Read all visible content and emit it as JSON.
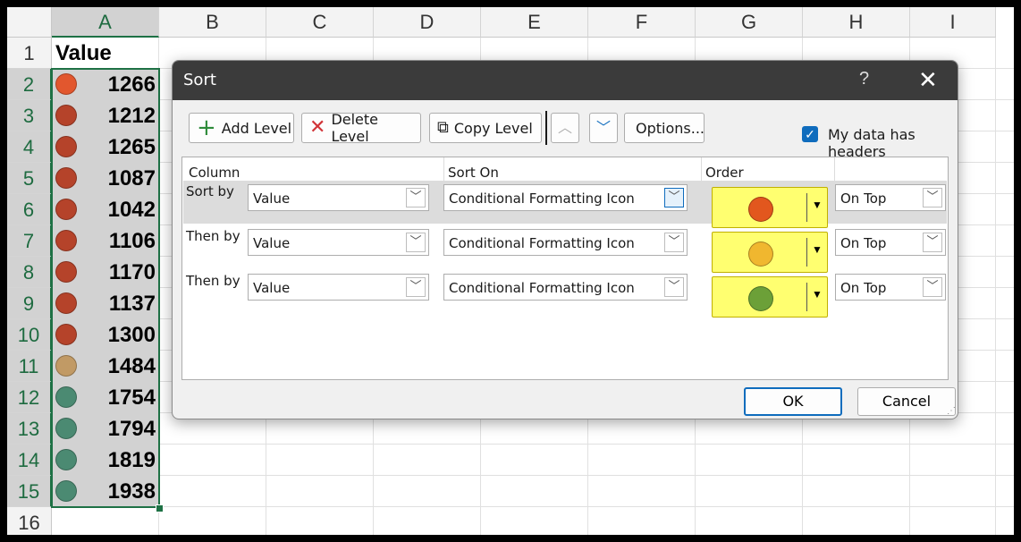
{
  "sheet": {
    "columns": [
      "A",
      "B",
      "C",
      "D",
      "E",
      "F",
      "G",
      "H",
      "I"
    ],
    "rows": [
      "1",
      "2",
      "3",
      "4",
      "5",
      "6",
      "7",
      "8",
      "9",
      "10",
      "11",
      "12",
      "13",
      "14",
      "15",
      "16"
    ],
    "header": "Value",
    "cells": [
      {
        "value": "1266",
        "icon": "orange-red-circle-icon",
        "color": "#e2572e"
      },
      {
        "value": "1212",
        "icon": "red-circle-icon",
        "color": "#b5432a"
      },
      {
        "value": "1265",
        "icon": "red-circle-icon",
        "color": "#b5432a"
      },
      {
        "value": "1087",
        "icon": "red-circle-icon",
        "color": "#b5432a"
      },
      {
        "value": "1042",
        "icon": "red-circle-icon",
        "color": "#b5432a"
      },
      {
        "value": "1106",
        "icon": "red-circle-icon",
        "color": "#b5432a"
      },
      {
        "value": "1170",
        "icon": "red-circle-icon",
        "color": "#b5432a"
      },
      {
        "value": "1137",
        "icon": "red-circle-icon",
        "color": "#b5432a"
      },
      {
        "value": "1300",
        "icon": "red-circle-icon",
        "color": "#b5432a"
      },
      {
        "value": "1484",
        "icon": "tan-circle-icon",
        "color": "#c19a65"
      },
      {
        "value": "1754",
        "icon": "green-circle-icon",
        "color": "#4b8a72"
      },
      {
        "value": "1794",
        "icon": "green-circle-icon",
        "color": "#4b8a72"
      },
      {
        "value": "1819",
        "icon": "green-circle-icon",
        "color": "#4b8a72"
      },
      {
        "value": "1938",
        "icon": "green-circle-icon",
        "color": "#4b8a72"
      }
    ]
  },
  "dialog": {
    "title": "Sort",
    "help": "?",
    "close": "✕",
    "toolbar": {
      "add_level": "Add Level",
      "delete_level": "Delete Level",
      "copy_level": "Copy Level",
      "move_up": "︿",
      "move_down": "﹀",
      "options": "Options..."
    },
    "has_headers_label": "My data has headers",
    "has_headers_checked": true,
    "columns": {
      "column": "Column",
      "sort_on": "Sort On",
      "order": "Order"
    },
    "levels": [
      {
        "label": "Sort by",
        "column": "Value",
        "sort_on": "Conditional Formatting Icon",
        "order_color": "#e2571e",
        "position": "On Top"
      },
      {
        "label": "Then by",
        "column": "Value",
        "sort_on": "Conditional Formatting Icon",
        "order_color": "#f0b72f",
        "position": "On Top"
      },
      {
        "label": "Then by",
        "column": "Value",
        "sort_on": "Conditional Formatting Icon",
        "order_color": "#6ca038",
        "position": "On Top"
      }
    ],
    "ok": "OK",
    "cancel": "Cancel"
  },
  "colors": {
    "highlight": "#ffff2e",
    "selection_green": "#1e7145",
    "accent_blue": "#0f6cbd"
  }
}
